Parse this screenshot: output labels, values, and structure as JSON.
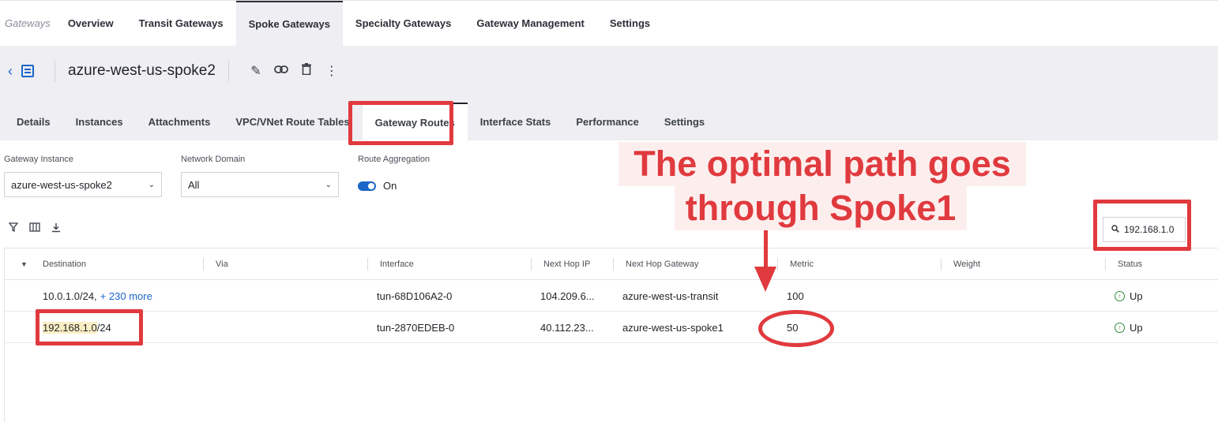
{
  "top_nav": {
    "brand": "Gateways",
    "items": [
      "Overview",
      "Transit Gateways",
      "Spoke Gateways",
      "Specialty Gateways",
      "Gateway Management",
      "Settings"
    ]
  },
  "header": {
    "title": "azure-west-us-spoke2",
    "tabs": [
      "Details",
      "Instances",
      "Attachments",
      "VPC/VNet Route Tables",
      "Gateway Routes",
      "Interface Stats",
      "Performance",
      "Settings"
    ]
  },
  "filters": {
    "gateway_instance_label": "Gateway Instance",
    "gateway_instance_value": "azure-west-us-spoke2",
    "network_domain_label": "Network Domain",
    "network_domain_value": "All",
    "route_aggregation_label": "Route Aggregation",
    "route_aggregation_state": "On"
  },
  "search": {
    "value": "192.168.1.0"
  },
  "table": {
    "columns": [
      "Destination",
      "Via",
      "Interface",
      "Next Hop IP",
      "Next Hop Gateway",
      "Metric",
      "Weight",
      "Status"
    ],
    "rows": [
      {
        "destination": "10.0.1.0/24,",
        "more": "+ 230 more",
        "via": "",
        "interface": "tun-68D106A2-0",
        "next_hop_ip": "104.209.6...",
        "next_hop_gateway": "azure-west-us-transit",
        "metric": "100",
        "weight": "",
        "status": "Up"
      },
      {
        "destination_hl": "192.168.1.0",
        "destination_rest": "/24",
        "via": "",
        "interface": "tun-2870EDEB-0",
        "next_hop_ip": "40.112.23...",
        "next_hop_gateway": "azure-west-us-spoke1",
        "metric": "50",
        "weight": "",
        "status": "Up"
      }
    ]
  },
  "annotation": {
    "line1": "The optimal path goes",
    "line2": "through Spoke1",
    "color": "#e03a3e"
  }
}
